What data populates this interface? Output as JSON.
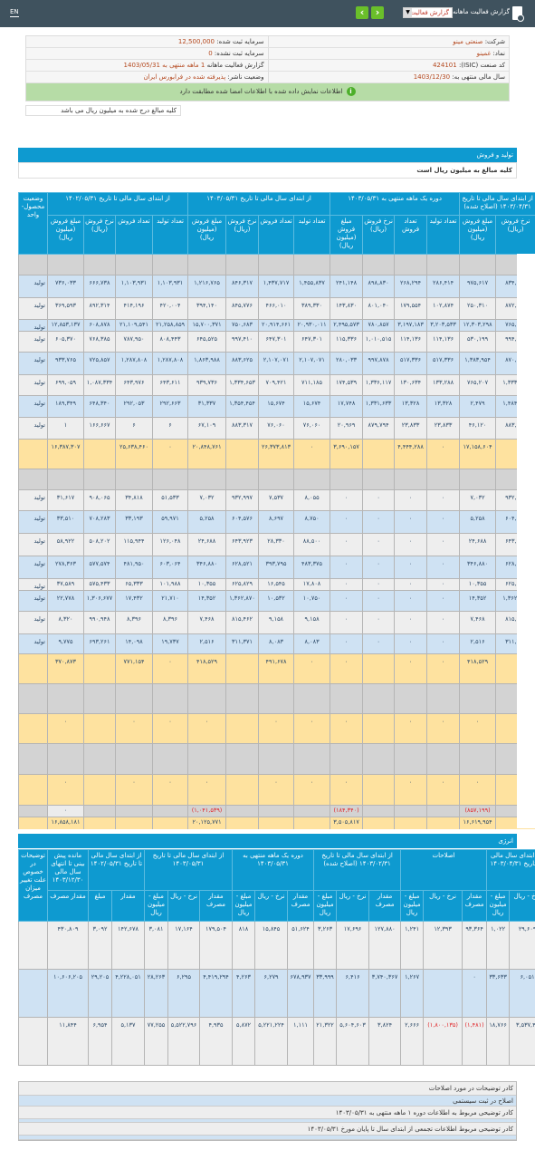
{
  "topbar": {
    "lang": "EN",
    "title": "گزارش فعالیت ماهانه",
    "select_value": "گزارش فعالیت",
    "prev_icon": "chevron-left",
    "next_icon": "chevron-right"
  },
  "info": {
    "company_label": "شرکت:",
    "company": "صنعتی مینو",
    "symbol_label": "نماد:",
    "symbol": "غمینو",
    "isic_label": "کد صنعت (ISIC):",
    "isic": "424101",
    "fy_label": "سال مالی منتهی به:",
    "fy": "1403/12/30",
    "cap_label": "سرمایه ثبت شده:",
    "cap": "12,500,000",
    "uncap_label": "سرمایه ثبت نشده:",
    "uncap": "0",
    "report_label": "گزارش فعالیت ماهانه",
    "report_period": "1 ماهه منتهی به",
    "report_date": "1403/05/31",
    "status_label": "وضعیت ناشر:",
    "status": "پذیرفته شده در فرابورس ایران",
    "match_msg": "اطلاعات نمایش داده شده با اطلاعات امضا شده مطابقت دارد",
    "unit_note": "کلیه مبالغ درج شده به میلیون ریال می باشد"
  },
  "colors": {
    "header": "#0e9ad0",
    "topbar": "#3f525e",
    "row_blue": "#cfe2f3",
    "row_gray": "#eeeeee",
    "total": "#fee29f",
    "negative": "#e0262a"
  },
  "production": {
    "title": "تولید و فروش",
    "unit": "کلیه مبالغ به میلیون ریال است",
    "status_header": "وضعیت محصول- واحد",
    "groups": [
      "از ابتدای سال مالی تا تاریخ ۱۴۰۲/۰۵/۳۱",
      "از ابتدای سال مالی تا تاریخ ۱۴۰۳/۰۵/۳۱",
      "دوره یک ماهه منتهی به ۱۴۰۳/۰۵/۳۱",
      "از ابتدای سال مالی تا تاریخ ۱۴۰۳/۰۴/۳۱ (اصلاح شده)"
    ],
    "subheaders": [
      "مبلغ فروش (میلیون ریال)",
      "نرخ فروش (ریال)",
      "تعداد فروش",
      "تعداد تولید"
    ],
    "rows": [
      {
        "kind": "dark",
        "status": "",
        "cells": [
          "",
          "",
          "",
          "",
          "",
          "",
          "",
          "",
          "",
          "",
          "",
          "",
          "",
          ""
        ]
      },
      {
        "kind": "blue",
        "status": "تولید",
        "cells": [
          "۷۳۶,۰۳۳",
          "۶۶۶,۷۳۸",
          "۱,۱۰۳,۹۳۱",
          "۱,۱۰۳,۹۳۱",
          "۱,۲۱۶,۷۶۵",
          "۸۴۶,۳۱۷",
          "۱,۴۳۷,۷۱۷",
          "۱,۴۵۵,۸۳۷",
          "۲۴۱,۱۴۸",
          "۸۹۸,۸۳۰",
          "۲۶۸,۲۹۴",
          "۲۸۶,۴۱۴",
          "۹۷۵,۶۱۷",
          "۸۳۴,۳۷۲"
        ]
      },
      {
        "kind": "gray",
        "status": "تولید",
        "cells": [
          "۳۶۹,۵۹۳",
          "۸۹۲,۳۱۴",
          "۴۱۴,۱۹۶",
          "۴۲۰,۰۰۴",
          "۳۹۴,۱۴۰",
          "۸۴۵,۷۷۶",
          "۴۶۶,۰۱۰",
          "۳۸۹,۳۳۰",
          "۱۴۳,۸۳۰",
          "۸۰۱,۰۴۰",
          "۱۷۹,۵۵۴",
          "۱۰۲,۸۷۴",
          "۲۵۰,۳۱۰",
          "۸۷۲,۸۱۷"
        ]
      },
      {
        "kind": "blue",
        "status": "تولید",
        "cells": [
          "۱۲,۸۵۳,۱۳۷",
          "۶۰۸,۸۷۸",
          "۲۱,۱۰۹,۵۴۱",
          "۲۱,۲۵۸,۸۵۹",
          "۱۵,۷۰۰,۳۷۱",
          "۷۵۰,۶۸۳",
          "۲۰,۹۱۴,۶۶۱",
          "۲۰,۹۳۰,۰۱۱",
          "۲,۴۹۵,۵۷۳",
          "۷۸۰,۸۵۷",
          "۳,۱۹۷,۱۸۳",
          "۳,۲۰۳,۵۳۳",
          "۱۲,۳۰۳,۲۹۸",
          "۷۶۵,۳۳۶"
        ]
      },
      {
        "kind": "gray",
        "status": "تولید",
        "cells": [
          "۶۰۵,۳۷۰",
          "۷۶۸,۳۸۵",
          "۷۸۷,۹۵۰",
          "۸۰۸,۴۴۳",
          "۶۴۵,۵۲۵",
          "۹۹۷,۴۱۰",
          "۶۴۷,۳۰۱",
          "۶۴۷,۳۰۱",
          "۱۱۵,۳۳۶",
          "۱,۰۱۰,۵۱۵",
          "۱۱۴,۱۳۶",
          "۱۱۴,۱۳۶",
          "۵۳۰,۱۹۹",
          "۹۹۴,۶۰۵"
        ]
      },
      {
        "kind": "blue",
        "status": "تولید",
        "cells": [
          "۹۳۳,۷۶۵",
          "۷۲۵,۸۵۷",
          "۱,۲۸۷,۸۰۸",
          "۱,۲۸۷,۸۰۸",
          "۱,۸۶۳,۹۸۸",
          "۸۸۳,۶۲۵",
          "۲,۱۰۷,۰۷۱",
          "۲,۱۰۷,۰۷۱",
          "۲۸۰,۰۳۳",
          "۹۹۷,۸۷۸",
          "۵۱۷,۳۳۶",
          "۵۱۷,۳۳۶",
          "۱,۳۸۳,۹۵۴",
          "۸۷۰,۵۶۲"
        ]
      },
      {
        "kind": "gray",
        "status": "تولید",
        "cells": [
          "۶۹۹,۰۵۹",
          "۱,۰۸۷,۳۳۴",
          "۶۴۳,۹۷۶",
          "۶۴۳,۶۱۱",
          "۹۳۹,۷۳۶",
          "۱,۳۳۴,۶۵۳",
          "۷۰۹,۴۲۱",
          "۷۱۱,۱۸۵",
          "۱۷۴,۵۳۹",
          "۱,۳۳۶,۱۱۷",
          "۱۳۰,۶۳۴",
          "۱۳۳,۲۸۸",
          "۷۶۵,۲۰۷",
          "۱,۳۳۳,۰۶۰"
        ]
      },
      {
        "kind": "blue",
        "status": "تولید",
        "cells": [
          "۱۸۹,۳۴۹",
          "۶۴۸,۳۴۰",
          "۲۹۲,۰۵۳",
          "۲۹۲,۶۶۳",
          "۳۱,۳۳۷",
          "۱,۳۵۴,۴۵۴",
          "۱۵,۶۷۴",
          "۱۵,۶۷۴",
          "۱۷,۷۴۸",
          "۱,۳۳۱,۶۳۳",
          "۱۳,۳۲۸",
          "۱۳,۳۲۸",
          "۲,۴۷۹",
          "۱,۴۸۴,۲۱۵"
        ]
      },
      {
        "kind": "gray",
        "status": "تولید",
        "cells": [
          "۱",
          "۱۶۶,۶۶۷",
          "۶",
          "۶",
          "۶۷,۱۰۹",
          "۸۸۳,۳۱۷",
          "۷۶,۰۶۰",
          "۷۶,۰۶۰",
          "۲۰,۹۶۹",
          "۸۷۹,۷۹۴",
          "۲۳,۸۳۳",
          "۲۳,۸۳۳",
          "۴۶,۱۲۰",
          "۸۸۳,۴۶۸"
        ]
      },
      {
        "kind": "yellow",
        "status": "",
        "cells": [
          "۱۶,۳۸۷,۳۰۷",
          "",
          "۲۵,۶۳۸,۴۶۰",
          "۰",
          "۲۰,۸۴۸,۷۶۱",
          "",
          "۲۶,۳۷۳,۸۱۳",
          "۰",
          "۳,۶۹۰,۱۵۷",
          "",
          "۴,۴۴۴,۲۸۸",
          "۰",
          "۱۷,۱۵۸,۶۰۴",
          ""
        ]
      },
      {
        "kind": "dark",
        "status": "",
        "cells": [
          "",
          "",
          "",
          "",
          "",
          "",
          "",
          "",
          "",
          "",
          "",
          "",
          "",
          ""
        ]
      },
      {
        "kind": "gray",
        "status": "تولید",
        "cells": [
          "۳۱,۶۱۷",
          "۹۰۸,۰۶۵",
          "۳۴,۸۱۸",
          "۵۱,۵۳۳",
          "۷,۰۳۲",
          "۹۳۲,۹۹۷",
          "۷,۵۳۷",
          "۸,۰۵۵",
          "۰",
          "۰",
          "۰",
          "۰",
          "۷,۰۳۲",
          "۹۳۲,۹۹۷"
        ]
      },
      {
        "kind": "blue",
        "status": "تولید",
        "cells": [
          "۳۳,۵۱۰",
          "۷۰۸,۲۸۳",
          "۳۳,۱۹۳",
          "۵۹,۹۷۱",
          "۵,۲۵۸",
          "۶۰۴,۵۷۶",
          "۸,۶۹۷",
          "۸,۷۵۰",
          "۰",
          "۰",
          "۰",
          "۰",
          "۵,۲۵۸",
          "۶۰۴,۵۷۶"
        ]
      },
      {
        "kind": "gray",
        "status": "تولید",
        "cells": [
          "۵۸,۹۲۲",
          "۵۰۸,۲۰۲",
          "۱۱۵,۹۴۴",
          "۱۲۶,۰۴۸",
          "۲۴,۶۸۸",
          "۶۴۳,۹۲۳",
          "۲۸,۳۳۰",
          "۸۸,۵۰۰",
          "۰",
          "۰",
          "۰",
          "۰",
          "۲۴,۶۸۸",
          "۶۴۳,۹۲۳"
        ]
      },
      {
        "kind": "blue",
        "status": "تولید",
        "cells": [
          "۲۷۸,۳۶۳",
          "۵۷۷,۵۷۴",
          "۴۸۱,۹۵۰",
          "۶۰۳,۰۶۴",
          "۳۴۶,۸۸۰",
          "۶۲۸,۵۲۱",
          "۳۹۳,۷۹۵",
          "۴۸۳,۳۷۵",
          "۰",
          "۰",
          "۰",
          "۰",
          "۳۴۶,۸۸۰",
          "۶۲۸,۵۲۱"
        ]
      },
      {
        "kind": "gray",
        "status": "تولید",
        "cells": [
          "۳۷,۵۸۹",
          "۵۷۵,۴۳۳",
          "۶۵,۳۳۳",
          "۱۰۱,۹۸۸",
          "۱۰,۳۵۵",
          "۶۲۵,۸۲۹",
          "۱۶,۵۴۵",
          "۱۷,۸۰۸",
          "۰",
          "۰",
          "۰",
          "۰",
          "۱۰,۳۵۵",
          "۶۲۵,۸۲۹"
        ]
      },
      {
        "kind": "blue",
        "status": "تولید",
        "cells": [
          "۲۲,۷۷۸",
          "۱,۳۰۶,۶۷۷",
          "۱۷,۴۳۲",
          "۲۱,۷۱۰",
          "۱۴,۳۵۲",
          "۱,۳۶۲,۸۷۰",
          "۱۰,۵۳۲",
          "۱۰,۷۵۰",
          "۰",
          "۰",
          "۰",
          "۰",
          "۱۴,۳۵۲",
          "۱,۳۶۲,۸۷۰"
        ]
      },
      {
        "kind": "gray",
        "status": "تولید",
        "cells": [
          "۸,۳۲۰",
          "۹۹۰,۹۴۸",
          "۸,۳۹۶",
          "۸,۳۹۶",
          "۷,۴۶۸",
          "۸۱۵,۴۶۲",
          "۹,۱۵۸",
          "۹,۱۵۸",
          "۰",
          "۰",
          "۰",
          "۰",
          "۷,۴۶۸",
          "۸۱۵,۴۶۲"
        ]
      },
      {
        "kind": "blue",
        "status": "تولید",
        "cells": [
          "۹,۷۷۵",
          "۶۹۳,۲۶۱",
          "۱۴,۰۹۸",
          "۱۹,۷۳۷",
          "۲,۵۱۶",
          "۳۱۱,۳۷۱",
          "۸,۰۸۳",
          "۸,۰۸۳",
          "۰",
          "۰",
          "۰",
          "۰",
          "۲,۵۱۶",
          "۳۱۱,۳۷۱"
        ]
      },
      {
        "kind": "yellow",
        "status": "",
        "cells": [
          "۳۷۰,۸۷۳",
          "",
          "۷۷۱,۱۵۴",
          "۰",
          "۴۱۸,۵۲۹",
          "",
          "۴۹۱,۶۷۸",
          "۰",
          "۰",
          "",
          "۰",
          "۰",
          "۴۱۸,۵۲۹",
          ""
        ]
      },
      {
        "kind": "dark",
        "status": "",
        "cells": [
          "",
          "",
          "",
          "",
          "",
          "",
          "",
          "",
          "",
          "",
          "",
          "",
          "",
          ""
        ]
      },
      {
        "kind": "yellow",
        "status": "",
        "cells": [
          "۰",
          "",
          "۰",
          "۰",
          "۰",
          "",
          "۰",
          "۰",
          "۰",
          "",
          "۰",
          "۰",
          "۰",
          ""
        ]
      },
      {
        "kind": "dark",
        "status": "",
        "cells": [
          "",
          "",
          "",
          "",
          "",
          "",
          "",
          "",
          "",
          "",
          "",
          "",
          "",
          ""
        ]
      },
      {
        "kind": "yellow",
        "status": "",
        "cells": [
          "۰",
          "",
          "۰",
          "۰",
          "۰",
          "",
          "۰",
          "۰",
          "۰",
          "",
          "۰",
          "۰",
          "۰",
          ""
        ]
      },
      {
        "kind": "neg",
        "status": "",
        "cells": [
          "۰",
          "",
          "",
          "",
          "(۱,۰۴۱,۵۳۹)",
          "",
          "",
          "",
          "(۱۸۴,۳۴۰)",
          "",
          "",
          "",
          "(۸۵۷,۱۹۹)",
          ""
        ]
      },
      {
        "kind": "yellow",
        "status": "",
        "cells": [
          "۱۶,۸۵۸,۱۸۱",
          "",
          "",
          "",
          "۲۰,۱۲۵,۷۷۱",
          "",
          "",
          "",
          "۳,۵۰۵,۸۱۷",
          "",
          "",
          "",
          "۱۶,۶۱۹,۹۵۴",
          ""
        ]
      }
    ]
  },
  "energy": {
    "title": "انرژی",
    "desc_header": "توضیحات در خصوص علت تغییر میزان مصرف",
    "groups": [
      {
        "label": "مانده پیش بینی تا انتهای سال مالی ۱۴۰۳/۱۲/۳۰",
        "subs": [
          "مقدار مصرف"
        ]
      },
      {
        "label": "از ابتدای سال مالی تا تاریخ ۱۴۰۲/۰۵/۳۱",
        "subs": [
          "مبلغ",
          "مقدار"
        ]
      },
      {
        "label": "از ابتدای سال مالی تا تاریخ ۱۴۰۳/۰۵/۳۱",
        "subs": [
          "مبلغ - میلیون ریال",
          "نرخ - ریال",
          "مقدار مصرف"
        ]
      },
      {
        "label": "دوره یک ماهه منتهی به ۱۴۰۳/۰۵/۳۱",
        "subs": [
          "مبلغ - میلیون ریال",
          "نرخ - ریال",
          "مقدار مصرف"
        ]
      },
      {
        "label": "از ابتدای سال مالی تا تاریخ ۱۴۰۳/۰۲/۳۱ (اصلاح شده)",
        "subs": [
          "مبلغ - میلیون ریال",
          "نرخ - ریال",
          "مقدار مصرف"
        ]
      },
      {
        "label": "اصلاحات",
        "subs": [
          "مبلغ - میلیون ریال",
          "نرخ - ریال",
          "مقدار مصرف"
        ]
      },
      {
        "label": "از ابتدای سال مالی تا تاریخ ۱۴۰۳/۰۴/۳۱",
        "subs": [
          "مبلغ - میلیون ریال",
          "نرخ - ریال"
        ]
      }
    ],
    "rows": [
      {
        "kind": "gray",
        "cells": [
          "۴۳۰,۸۰۹",
          "۳,۰۹۲",
          "۱۴۲,۶۷۸",
          "۳,۰۸۱",
          "۱۷,۱۶۴",
          "۱۷۹,۵۰۴",
          "۸۱۸",
          "۱۵,۸۴۵",
          "۵۱,۶۲۴",
          "۳,۲۶۳",
          "۱۷,۶۹۶",
          "۱۲۷,۸۸۰",
          "۱,۲۴۱",
          "۱۲,۳۹۳",
          "۹۳,۳۶۴",
          "۱,۰۲۲",
          "۲۹,۶۰۹"
        ]
      },
      {
        "kind": "blue",
        "cells": [
          "۱۰,۶۰۶,۲۰۵",
          "۲۹,۲۰۵",
          "۴,۲۲۸,۰۵۱",
          "۲۸,۲۶۳",
          "۶,۲۹۵",
          "۴,۴۱۹,۲۹۴",
          "۴,۲۶۳",
          "۶,۲۷۹",
          "۶۷۸,۹۳۷",
          "۳۳,۹۹۹",
          "۶,۴۱۶",
          "۳,۷۴۰,۳۶۷",
          "۱,۲۶۷",
          "",
          "۰",
          "۳۳,۶۳۳",
          "۶,۰۵۱"
        ]
      },
      {
        "kind": "gray",
        "cells": [
          "۱۱,۸۴۴",
          "۶,۹۵۴",
          "۵,۱۳۷",
          "۷۷,۲۵۵",
          "۵,۵۲۲,۷۹۶",
          "۴,۹۳۵",
          "۵,۸۷۲",
          "۵,۲۲۱,۲۲۴",
          "۱,۱۱۱",
          "۲۱,۳۲۲",
          "۵,۶۰۴,۶۰۳",
          "۳,۸۲۴",
          "۲,۶۶۶",
          "(۱,۸۰۰,۱۳۵)",
          "(۱,۴۸۱)",
          "۱۸,۷۶۶",
          "۳,۵۳۷,۴۱"
        ]
      }
    ]
  },
  "footer": {
    "items": [
      "کادر توضیحات در مورد اصلاحات",
      "اصلاح در ثبت سیستمی",
      "کادر توضیحی مربوط به اطلاعات دوره ۱ ماهه منتهی به ۱۴۰۳/۰۵/۳۱",
      "",
      "کادر توضیحی مربوط اطلاعات تجمعی از ابتدای سال تا پایان مورخ ۱۴۰۳/۰۵/۳۱",
      ""
    ]
  }
}
